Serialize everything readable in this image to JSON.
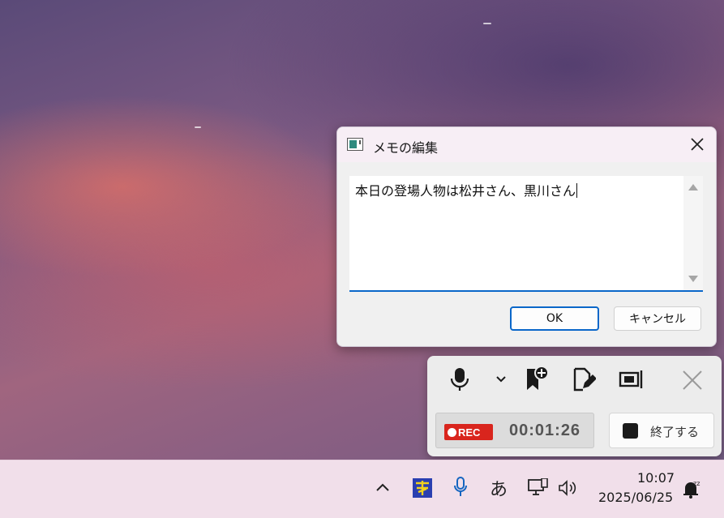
{
  "dialog": {
    "title": "メモの編集",
    "memo_text": "本日の登場人物は松井さん、黒川さん",
    "ok_label": "OK",
    "cancel_label": "キャンセル"
  },
  "recorder": {
    "rec_label": "REC",
    "elapsed": "00:01:26",
    "stop_label": "終了する",
    "icons": [
      "microphone-icon",
      "chevron-down-icon",
      "bookmark-add-icon",
      "edit-note-icon",
      "screen-capture-icon",
      "close-icon"
    ]
  },
  "taskbar": {
    "ime_mode": "あ",
    "time": "10:07",
    "date": "2025/06/25",
    "icons": [
      "chevron-up-icon",
      "ime-app-icon",
      "microphone-icon",
      "network-icon",
      "volume-icon",
      "notification-snooze-icon"
    ]
  },
  "colors": {
    "accent": "#0a67c9",
    "rec_red": "#d9251d",
    "taskbar_bg": "#f1dfea"
  }
}
